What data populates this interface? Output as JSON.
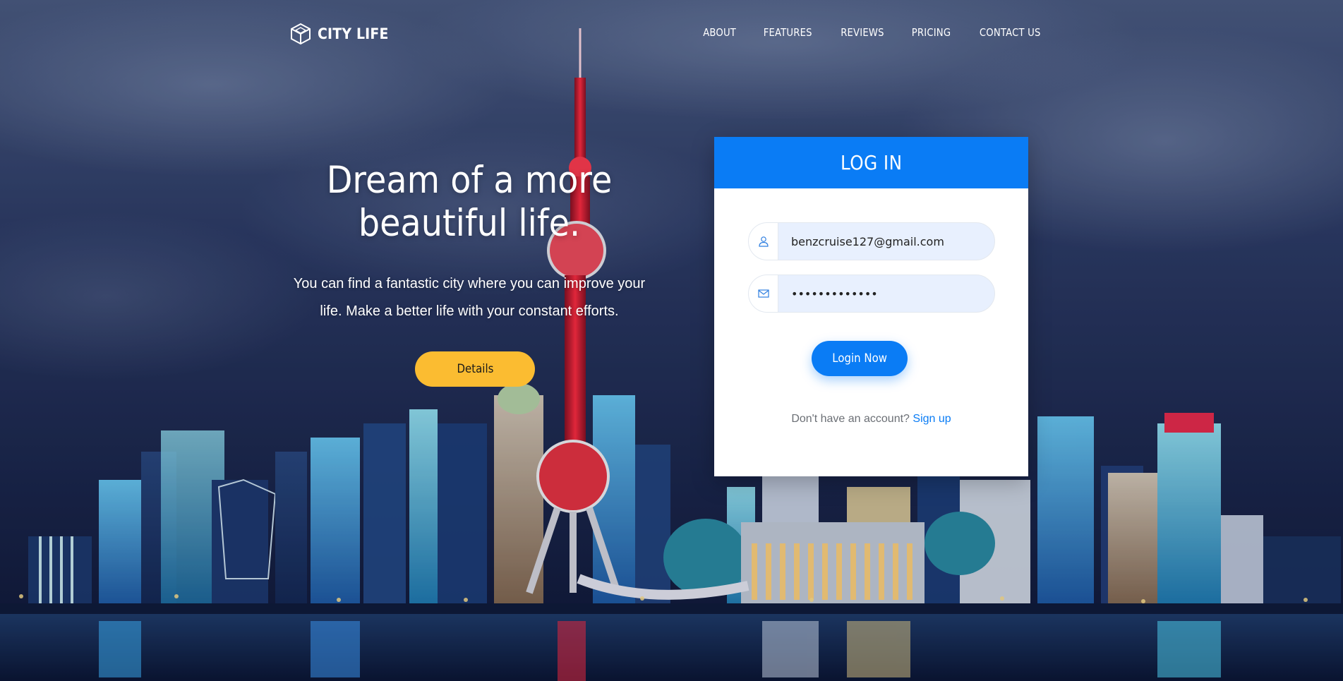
{
  "brand": {
    "name": "CITY LIFE",
    "icon": "cube-logo-icon"
  },
  "nav": {
    "items": [
      {
        "label": "ABOUT"
      },
      {
        "label": "FEATURES"
      },
      {
        "label": "REVIEWS"
      },
      {
        "label": "PRICING"
      },
      {
        "label": "CONTACT US"
      }
    ]
  },
  "hero": {
    "title_line1": "Dream of a more",
    "title_line2": "beautiful life.",
    "subtitle_line1": "You can find a fantastic city where you can improve your",
    "subtitle_line2": "life. Make a better life with your constant efforts.",
    "details_label": "Details"
  },
  "background": {
    "description_icon": "city-skyline-night-image"
  },
  "login": {
    "title": "LOG IN",
    "email_value": "benzcruise127@gmail.com",
    "email_icon": "user-icon",
    "password_value": "•••••••••••••",
    "password_icon": "envelope-icon",
    "button_label": "Login Now",
    "signup_prompt": "Don't have an account?",
    "signup_link": "Sign up"
  },
  "colors": {
    "primary": "#0a7cf5",
    "accent": "#fbbc31",
    "field_bg": "#e8f0fe"
  }
}
